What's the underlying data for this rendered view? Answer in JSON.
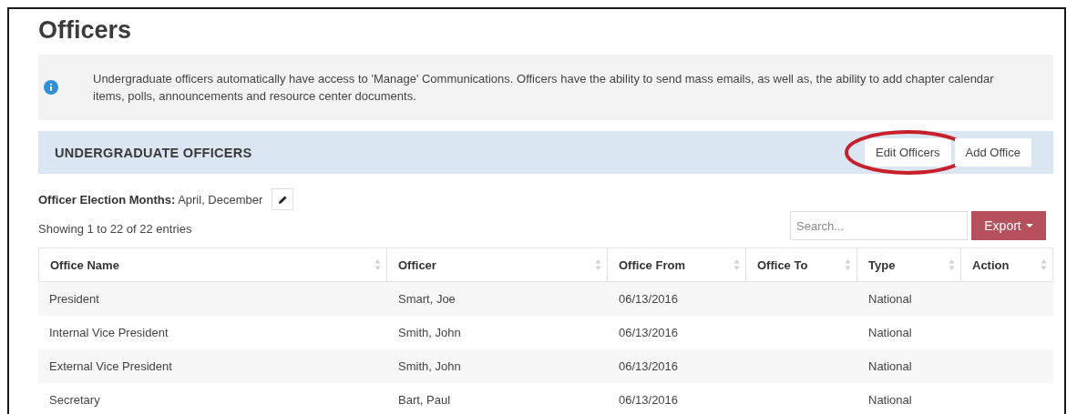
{
  "page": {
    "title": "Officers"
  },
  "notice": {
    "text": "Undergraduate officers automatically have access to 'Manage' Communications. Officers have the ability to send mass emails, as well as, the ability to add chapter calendar items, polls, announcements and resource center documents."
  },
  "section": {
    "title": "UNDERGRADUATE OFFICERS",
    "buttons": [
      {
        "label": "Edit Officers",
        "circled": true
      },
      {
        "label": "Add Office",
        "circled": false
      }
    ]
  },
  "election_months": {
    "label": "Officer Election Months:",
    "value": "April, December"
  },
  "table_info": "Showing 1 to 22 of 22 entries",
  "search": {
    "placeholder": "Search..."
  },
  "export": {
    "label": "Export"
  },
  "table": {
    "columns": [
      "Office Name",
      "Officer",
      "Office From",
      "Office To",
      "Type",
      "Action"
    ],
    "rows": [
      [
        "President",
        "Smart, Joe",
        "06/13/2016",
        "",
        "National",
        ""
      ],
      [
        "Internal Vice President",
        "Smith, John",
        "06/13/2016",
        "",
        "National",
        ""
      ],
      [
        "External Vice President",
        "Smith, John",
        "06/13/2016",
        "",
        "National",
        ""
      ],
      [
        "Secretary",
        "Bart, Paul",
        "06/13/2016",
        "",
        "National",
        ""
      ]
    ]
  }
}
